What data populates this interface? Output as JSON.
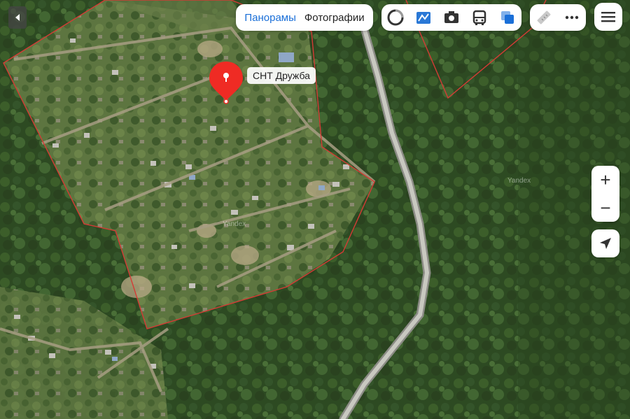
{
  "map": {
    "type": "satellite",
    "place_label": "СНТ Дружба",
    "watermark": "Yandex",
    "pin_color": "#ef2b24",
    "boundary_color": "#d43b35",
    "road_color": "#b9b9b1"
  },
  "top_tabs": {
    "panoramas": "Панорамы",
    "photos": "Фотографии",
    "active": "panoramas",
    "accent_color": "#1a6fd8"
  },
  "layers": [
    "layers-icon",
    "traffic-icon",
    "camera-icon",
    "transit-bus-icon",
    "layer-switch-icon"
  ],
  "tools": [
    "ruler-icon",
    "more-icon"
  ],
  "menu": "hamburger-menu-icon",
  "zoom": {
    "in": "+",
    "out": "−"
  }
}
